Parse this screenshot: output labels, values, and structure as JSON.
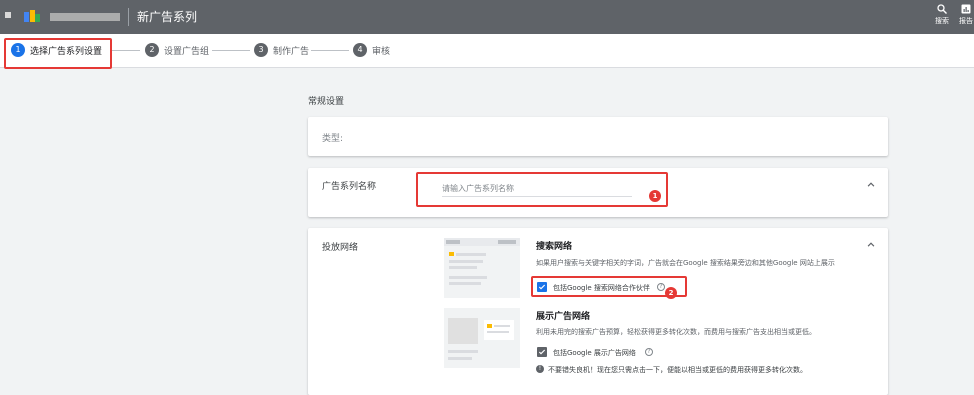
{
  "topbar": {
    "title": "新广告系列",
    "actions": [
      {
        "label": "搜索",
        "icon": "search-icon"
      },
      {
        "label": "报告",
        "icon": "reports-icon"
      }
    ]
  },
  "stepper": {
    "steps": [
      {
        "num": "1",
        "label": "选择广告系列设置",
        "active": true
      },
      {
        "num": "2",
        "label": "设置广告组"
      },
      {
        "num": "3",
        "label": "制作广告"
      },
      {
        "num": "4",
        "label": "审核"
      }
    ]
  },
  "main": {
    "section_title": "常规设置",
    "type_label": "类型:",
    "campaign_name": {
      "label": "广告系列名称",
      "placeholder": "请输入广告系列名称",
      "value": ""
    },
    "network": {
      "label": "投放网络",
      "search": {
        "heading": "搜索网络",
        "description": "如果用户搜索与关键字相关的字词，广告就会在Google 搜索结果旁边和其他Google 网站上展示",
        "checkbox_label": "包括Google 搜索网络合作伙伴",
        "checked": true
      },
      "display": {
        "heading": "展示广告网络",
        "description": "利用未用完的搜索广告预算，轻松获得更多转化次数，而费用与搜索广告支出相当或更低。",
        "checkbox_label": "包括Google 展示广告网络",
        "checked": true,
        "tip": "不要错失良机！现在您只需点击一下，便能以相当或更低的费用获得更多转化次数。"
      }
    }
  },
  "annotations": {
    "marker1": "1",
    "marker2": "2"
  },
  "colors": {
    "topbar": "#5f6368",
    "accent": "#1a73e8",
    "annotation": "#e53935"
  }
}
